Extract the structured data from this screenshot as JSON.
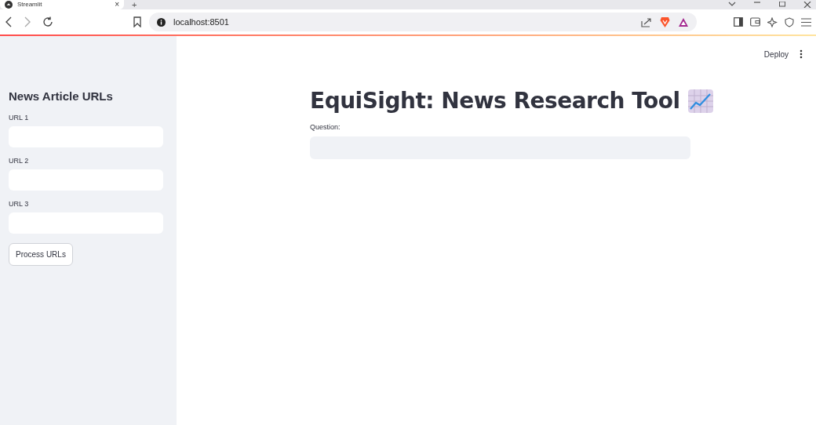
{
  "browser": {
    "tab_title": "Streamlit",
    "tab_close": "×",
    "new_tab": "+",
    "address": "localhost:8501"
  },
  "header": {
    "deploy": "Deploy"
  },
  "sidebar": {
    "title": "News Article URLs",
    "fields": [
      {
        "label": "URL 1"
      },
      {
        "label": "URL 2"
      },
      {
        "label": "URL 3"
      }
    ],
    "button": "Process URLs"
  },
  "main": {
    "title": "EquiSight: News Research Tool",
    "question_label": "Question:"
  }
}
